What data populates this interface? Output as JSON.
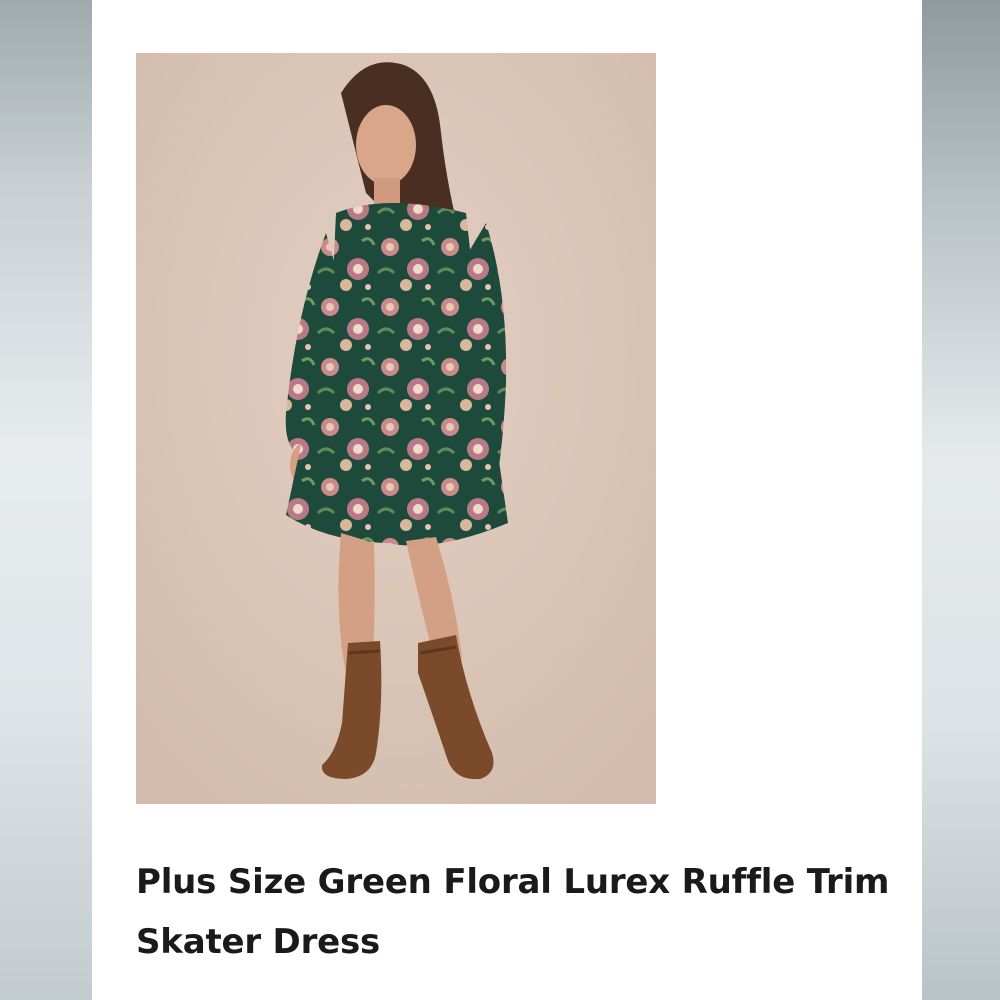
{
  "product": {
    "title_line1": "Plus Size Green Floral Lurex Ruffle Trim",
    "title_line2": "Skater Dress",
    "image_alt": "Model wearing green floral long-sleeve skater dress with brown western boots"
  },
  "colors": {
    "image_background": "#dcc7b9",
    "dress_green": "#1f4a3c",
    "boot_brown": "#7a4a2a",
    "title_text": "#1a1a1a"
  }
}
